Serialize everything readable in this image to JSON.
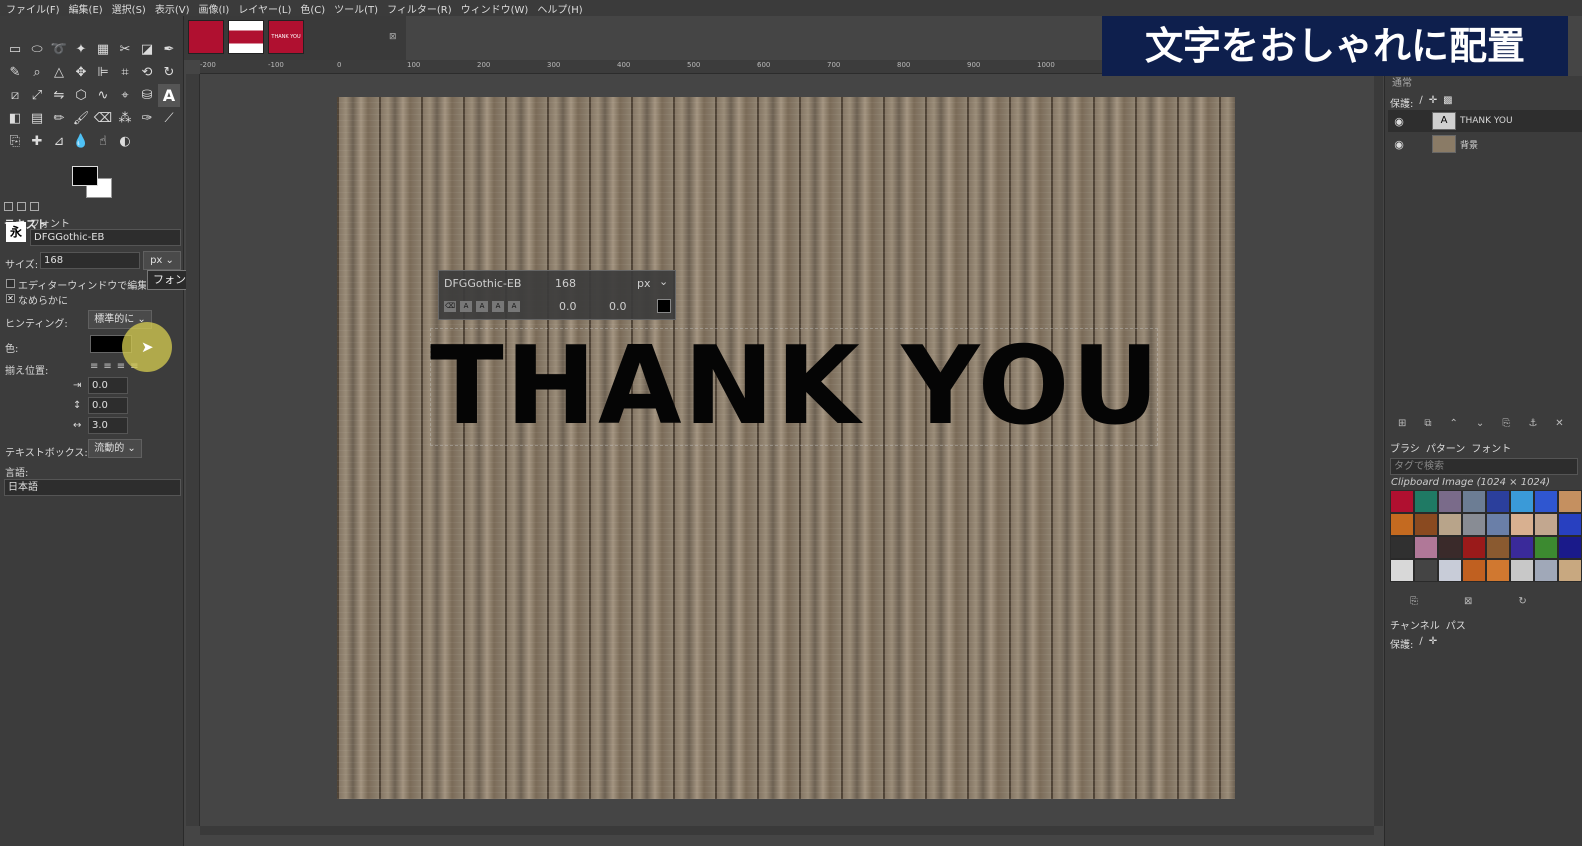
{
  "menu": [
    "ファイル(F)",
    "編集(E)",
    "選択(S)",
    "表示(V)",
    "画像(I)",
    "レイヤー(L)",
    "色(C)",
    "ツール(T)",
    "フィルター(R)",
    "ウィンドウ(W)",
    "ヘルプ(H)"
  ],
  "banner": "文字をおしゃれに配置",
  "tool_options": {
    "title": "テキスト",
    "font_label": "フォント",
    "font_icon": "永",
    "font_value": "DFGGothic-EB",
    "size_label": "サイズ:",
    "size_value": "168",
    "size_unit": "px",
    "tooltip": "フォントサイズを設定します",
    "editor_label": "エディターウィンドウで編集",
    "antialias_label": "なめらかに",
    "hinting_label": "ヒンティング:",
    "hinting_value": "標準的に",
    "color_label": "色:",
    "justify_label": "揃え位置:",
    "indent_value": "0.0",
    "line_spacing_value": "0.0",
    "letter_spacing_value": "3.0",
    "textbox_label": "テキストボックス:",
    "textbox_value": "流動的",
    "language_label": "言語:",
    "language_value": "日本語"
  },
  "image_tab_label": "THANK YOU",
  "ruler_marks": [
    "-200",
    "-100",
    "0",
    "100",
    "200",
    "300",
    "400",
    "500",
    "600",
    "700",
    "800",
    "900",
    "1000"
  ],
  "canvas_text": "THANK YOU",
  "on_canvas_bar": {
    "font": "DFGGothic-EB",
    "size": "168",
    "unit": "px",
    "baseline": "0.0",
    "kerning": "0.0"
  },
  "layers": {
    "mode_label": "通常",
    "protect_label": "保護:",
    "items": [
      {
        "name": "THANK YOU",
        "selected": true
      },
      {
        "name": "背景",
        "selected": false
      }
    ]
  },
  "resources_tabs": [
    "ブラシ",
    "パターン",
    "フォント"
  ],
  "tag_filter_placeholder": "タグで検索",
  "pattern_selected": "Clipboard Image (1024 × 1024)",
  "bottom_tabs": [
    "チャンネル",
    "パス"
  ],
  "bottom_protect_label": "保護:",
  "colors": {
    "banner_bg": "#0e1f4d",
    "fg": "#000000",
    "bg": "#ffffff",
    "highlight": "#d7cd50"
  }
}
